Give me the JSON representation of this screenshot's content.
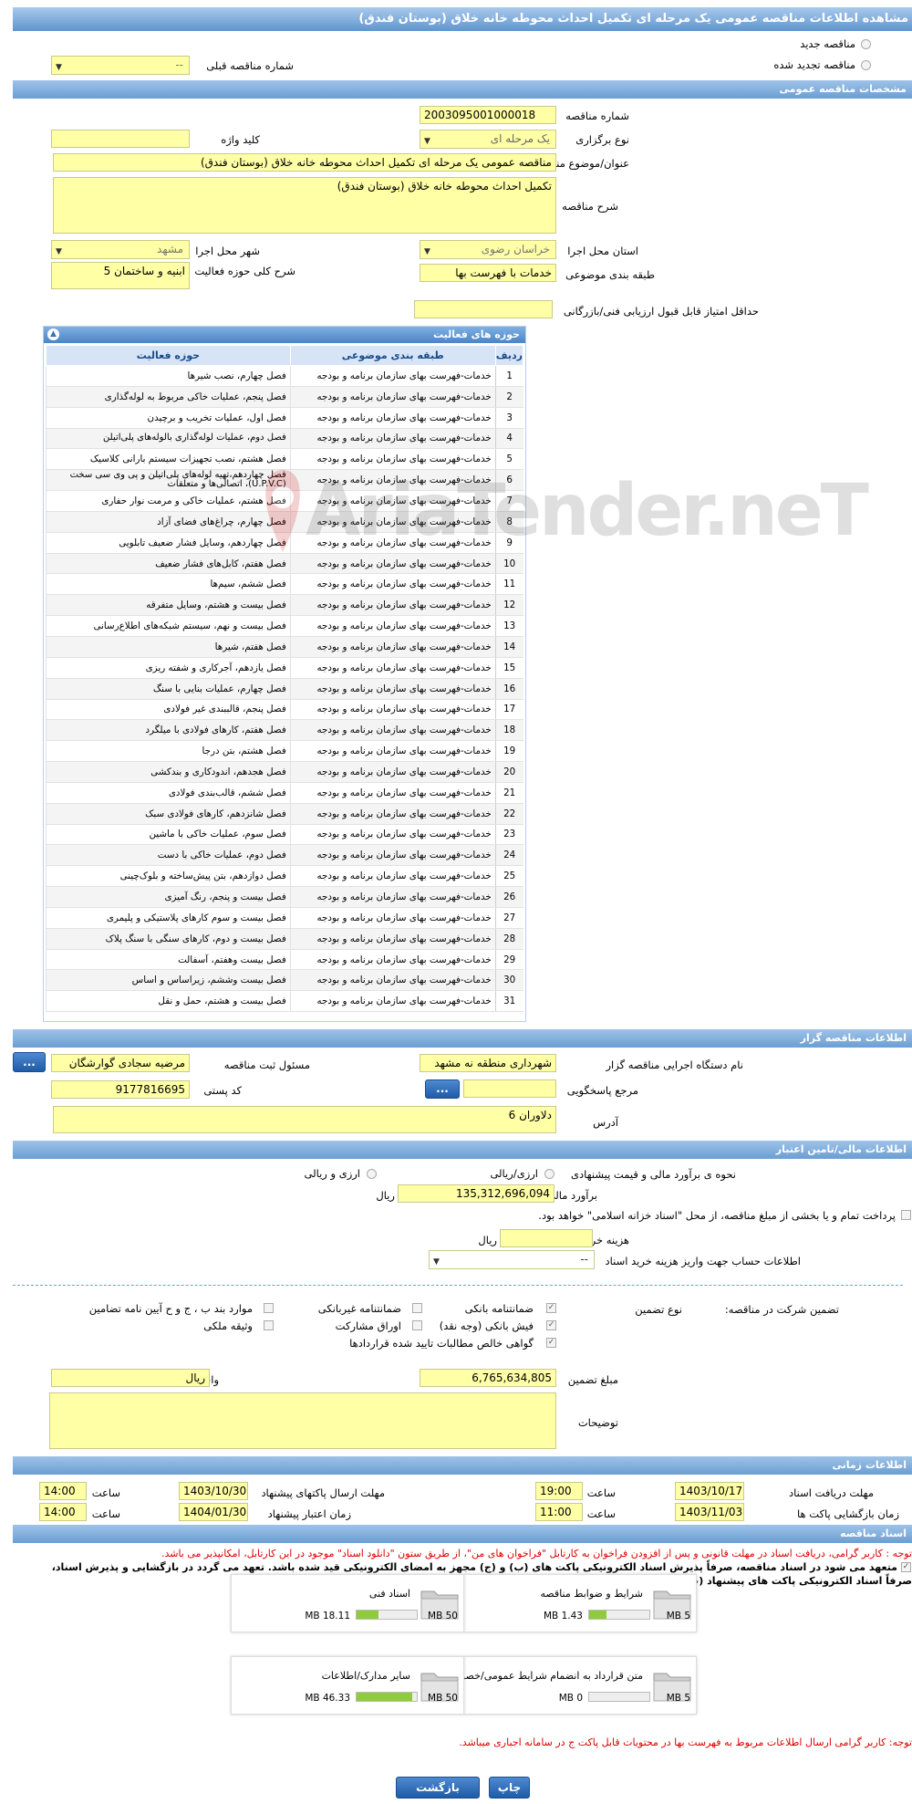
{
  "title": "مشاهده اطلاعات مناقصه عمومی یک مرحله ای تکمیل احداث محوطه خانه خلاق (بوستان فندق)",
  "top": {
    "radio_new": "مناقصه جدید",
    "radio_renew": "مناقصه تجدید شده",
    "prev_label": "شماره مناقصه قبلی",
    "prev_value": "--"
  },
  "general": {
    "header": "مشخصات مناقصه عمومی",
    "number_label": "شماره مناقصه",
    "number": "2003095001000018",
    "type_label": "نوع برگزاری",
    "type": "یک مرحله ای",
    "keyword_label": "کلید واژه",
    "keyword": "",
    "subject_label": "عنوان/موضوع مناقصه",
    "subject": "مناقصه عمومی یک مرحله ای تکمیل احداث محوطه خانه خلاق (بوستان فندق)",
    "desc_label": "شرح مناقصه",
    "desc": "تکمیل احداث محوطه خانه خلاق (بوستان فندق)",
    "province_label": "استان محل اجرا",
    "province": "خراسان رضوی",
    "city_label": "شهر محل اجرا",
    "city": "مشهد",
    "category_label": "طبقه بندی موضوعی",
    "category": "خدمات با فهرست بها",
    "scope_label": "شرح کلی حوزه فعالیت",
    "scope": "ابنیه و ساختمان 5",
    "min_score_label": "حداقل امتیاز قابل قبول ارزیابی فنی/بازرگانی",
    "min_score": ""
  },
  "activity": {
    "header": "حوزه های فعالیت",
    "columns": [
      "ردیف",
      "طبقه بندی موضوعی",
      "حوزه فعالیت"
    ],
    "rows": [
      [
        "1",
        "خدمات-فهرست بهای سازمان برنامه و بودجه",
        "فصل چهارم، نصب شیرها"
      ],
      [
        "2",
        "خدمات-فهرست بهای سازمان برنامه و بودجه",
        "فصل پنجم، عملیات خاکی مربوط به لوله‌گذاری"
      ],
      [
        "3",
        "خدمات-فهرست بهای سازمان برنامه و بودجه",
        "فصل اول، عملیات تخریب و برچیدن"
      ],
      [
        "4",
        "خدمات-فهرست بهای سازمان برنامه و بودجه",
        "فصل دوم، عملیات لوله‌گذاری بالوله‌های پلی‌اتیلن"
      ],
      [
        "5",
        "خدمات-فهرست بهای سازمان برنامه و بودجه",
        "فصل هشتم، نصب تجهیزات سیستم بارانی کلاسیک"
      ],
      [
        "6",
        "خدمات-فهرست بهای سازمان برنامه و بودجه",
        "فصل چهاردهم،تهیه لوله‌های پلی‌اتیلن و پی وی سی سخت (U.P.V.C)، اتصالی‌ها و متعلقات"
      ],
      [
        "7",
        "خدمات-فهرست بهای سازمان برنامه و بودجه",
        "فصل هشتم، عملیات خاکی و مرمت نوار حفاری"
      ],
      [
        "8",
        "خدمات-فهرست بهای سازمان برنامه و بودجه",
        "فصل چهارم، چراغ‌های فضای آزاد"
      ],
      [
        "9",
        "خدمات-فهرست بهای سازمان برنامه و بودجه",
        "فصل چهاردهم، وسایل فشار ضعیف تابلویی"
      ],
      [
        "10",
        "خدمات-فهرست بهای سازمان برنامه و بودجه",
        "فصل هفتم، کابل‌های فشار ضعیف"
      ],
      [
        "11",
        "خدمات-فهرست بهای سازمان برنامه و بودجه",
        "فصل ششم، سیم‌ها"
      ],
      [
        "12",
        "خدمات-فهرست بهای سازمان برنامه و بودجه",
        "فصل بیست و هشتم، وسایل متفرقه"
      ],
      [
        "13",
        "خدمات-فهرست بهای سازمان برنامه و بودجه",
        "فصل بیست و نهم، سیستم شبکه‌های اطلاع‌رسانی"
      ],
      [
        "14",
        "خدمات-فهرست بهای سازمان برنامه و بودجه",
        "فصل هفتم، شیرها"
      ],
      [
        "15",
        "خدمات-فهرست بهای سازمان برنامه و بودجه",
        "فصل یازدهم، آجرکاری و شفته ریزی"
      ],
      [
        "16",
        "خدمات-فهرست بهای سازمان برنامه و بودجه",
        "فصل چهارم، عملیات بنایی با سنگ"
      ],
      [
        "17",
        "خدمات-فهرست بهای سازمان برنامه و بودجه",
        "فصل پنجم، قالببندی غیر فولادی"
      ],
      [
        "18",
        "خدمات-فهرست بهای سازمان برنامه و بودجه",
        "فصل هفتم، کارهای فولادی با میلگرد"
      ],
      [
        "19",
        "خدمات-فهرست بهای سازمان برنامه و بودجه",
        "فصل هشتم، بتن درجا"
      ],
      [
        "20",
        "خدمات-فهرست بهای سازمان برنامه و بودجه",
        "فصل هجدهم، اندودکاری و بندکشی"
      ],
      [
        "21",
        "خدمات-فهرست بهای سازمان برنامه و بودجه",
        "فصل ششم، قالب‌بندی فولادی"
      ],
      [
        "22",
        "خدمات-فهرست بهای سازمان برنامه و بودجه",
        "فصل شانزدهم، کارهای فولادی سبک"
      ],
      [
        "23",
        "خدمات-فهرست بهای سازمان برنامه و بودجه",
        "فصل سوم، عملیات خاکی با ماشین"
      ],
      [
        "24",
        "خدمات-فهرست بهای سازمان برنامه و بودجه",
        "فصل دوم، عملیات خاکی با دست"
      ],
      [
        "25",
        "خدمات-فهرست بهای سازمان برنامه و بودجه",
        "فصل دوازدهم، بتن پیش‌ساخته و بلوک‌چینی"
      ],
      [
        "26",
        "خدمات-فهرست بهای سازمان برنامه و بودجه",
        "فصل بیست و پنجم، رنگ آمیزی"
      ],
      [
        "27",
        "خدمات-فهرست بهای سازمان برنامه و بودجه",
        "فصل بیست و سوم کارهای پلاستیکی و پلیمری"
      ],
      [
        "28",
        "خدمات-فهرست بهای سازمان برنامه و بودجه",
        "فصل بیست و دوم، کارهای سنگی با سنگ پلاک"
      ],
      [
        "29",
        "خدمات-فهرست بهای سازمان برنامه و بودجه",
        "فصل بیست وهفتم، آسفالت"
      ],
      [
        "30",
        "خدمات-فهرست بهای سازمان برنامه و بودجه",
        "فصل بیست وششم، زیراساس و اساس"
      ],
      [
        "31",
        "خدمات-فهرست بهای سازمان برنامه و بودجه",
        "فصل بیست و هشتم، حمل و نقل"
      ]
    ]
  },
  "organizer": {
    "header": "اطلاعات مناقصه گزار",
    "org_label": "نام دستگاه اجرایی مناقصه گزار",
    "org": "شهرداری منطقه نه مشهد",
    "resp_label": "مسئول ثبت مناقصه",
    "resp": "مرضیه سجادی گوارشگان",
    "ref_label": "مرجع پاسخگویی",
    "ref": "",
    "postal_label": "کد پستی",
    "postal": "9177816695",
    "addr_label": "آدرس",
    "addr": "دلاوران 6",
    "dots": "..."
  },
  "finance": {
    "header": "اطلاعات مالی/تامین اعتبار",
    "method_label": "نحوه ی برآورد مالی و قیمت پیشنهادی",
    "opt1": "ارزی/ریالی",
    "opt2": "ارزی و ریالی",
    "estimate_label": "برآورد مالی",
    "estimate": "135,312,696,094",
    "rial": "ریال",
    "treasury": "پرداخت تمام و یا بخشی از مبلغ مناقصه، از محل \"اسناد خزانه اسلامی\" خواهد بود.",
    "doc_cost_label": "هزینه خرید اسناد",
    "doc_cost": "",
    "rial2": "ریال",
    "account_label": "اطلاعات حساب جهت واریز هزینه خرید اسناد",
    "account": "--",
    "guarantee_label": "تضمین شرکت در مناقصه:",
    "gtype_label": "نوع تضمین",
    "g1": "ضمانتنامه بانکی",
    "g2": "ضمانتنامه غیربانکی",
    "g3": "موارد بند ب ، ج و ح آیین نامه تضامین",
    "g4": "فیش بانکی (وجه نقد)",
    "g5": "اوراق مشارکت",
    "g6": "وثیقه ملکی",
    "g7": "گواهی خالص مطالبات تایید شده قراردادها",
    "amount_label": "مبلغ تضمین",
    "amount": "6,765,634,805",
    "unit_label": "واحد پول",
    "unit": "ریال",
    "notes_label": "توضیحات",
    "notes": ""
  },
  "schedule": {
    "header": "اطلاعات زمانی",
    "recv_label": "مهلت دریافت اسناد",
    "recv_date": "1403/10/17",
    "recv_time": "19:00",
    "send_label": "مهلت ارسال پاکتهای پیشنهاد",
    "send_date": "1403/10/30",
    "send_time": "14:00",
    "open_label": "زمان بازگشایی پاکت ها",
    "open_date": "1403/11/03",
    "open_time": "11:00",
    "valid_label": "زمان اعتبار پیشنهاد",
    "valid_date": "1404/01/30",
    "valid_time": "14:00",
    "time_label": "ساعت"
  },
  "documents": {
    "header": "اسناد مناقصه",
    "notice1": "توجه : کاربر گرامی، دریافت اسناد در مهلت قانونی و پس از افزودن فراخوان به کارتابل \"فراخوان های من\"، از طریق ستون \"دانلود اسناد\" موجود در این کارتابل، امکانپذیر می باشد.",
    "notice2": "متعهد می شود در اسناد مناقصه، صرفاً پذیرش اسناد الکترونیکی پاکت های (ب) و (ج) مجهز به امضای الکترونیکی قید شده باشد. تعهد می گردد در بازگشایی و پذیرش اسناد،",
    "notice3": "صرفاً اسناد الکترونیکی پاکت های پیشنهاد (ب) و (ج) مجهز به امضای الکترونیکی صاحبان امضای مجاز مورد پذیرش واقع گردد.",
    "files": [
      {
        "name": "شرایط و ضوابط مناقصه",
        "size": "1.43 MB",
        "max": "5 MB",
        "pct": 0.29
      },
      {
        "name": "اسناد فنی",
        "size": "18.11 MB",
        "max": "50 MB",
        "pct": 0.36
      },
      {
        "name": "متن قرارداد به انضمام شرایط عمومی/خصوصی",
        "size": "0 MB",
        "max": "5 MB",
        "pct": 0
      },
      {
        "name": "سایر مدارک/اطلاعات",
        "size": "46.33 MB",
        "max": "50 MB",
        "pct": 0.93
      }
    ],
    "footer_notice": "توجه: کاربر گرامی ارسال اطلاعات مربوط به فهرست بها در محتویات قابل پاکت ج در سامانه اجباری میباشد."
  },
  "buttons": {
    "back": "بازگشت",
    "print": "چاپ"
  },
  "watermark": "AriaTender.neT",
  "colors": {
    "accent": "#6a9ed4",
    "field": "#ffffa6",
    "notice": "#d00000"
  }
}
